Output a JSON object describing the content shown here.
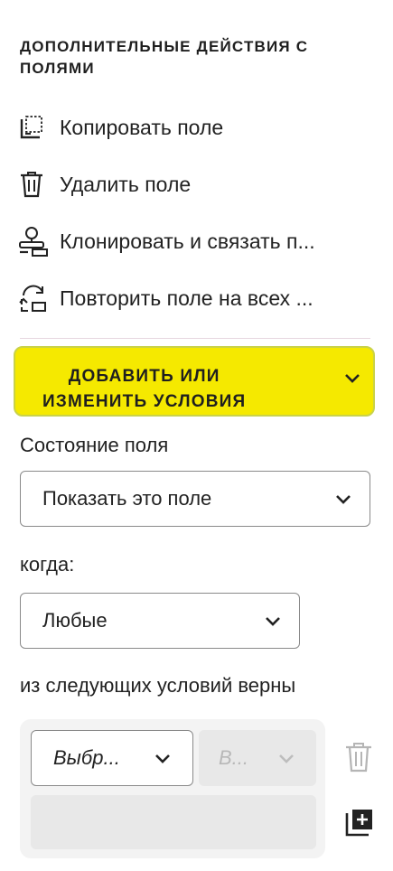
{
  "section": {
    "title": "ДОПОЛНИТЕЛЬНЫЕ ДЕЙСТВИЯ С ПОЛЯМИ"
  },
  "actions": [
    {
      "icon": "copy-field-icon",
      "label": "Копировать поле"
    },
    {
      "icon": "trash-icon",
      "label": "Удалить поле"
    },
    {
      "icon": "clone-link-icon",
      "label": "Клонировать и связать п..."
    },
    {
      "icon": "repeat-all-pages-icon",
      "label": "Повторить поле на всех ..."
    }
  ],
  "conditions": {
    "title_line1": "ДОБАВИТЬ ИЛИ",
    "title_line2": "ИЗМЕНИТЬ УСЛОВИЯ",
    "field_state_label": "Состояние поля",
    "field_state_value": "Показать это поле",
    "when_label": "когда:",
    "when_value": "Любые",
    "following_label": "из следующих условий верны",
    "condition_field_value": "Выбр...",
    "condition_operator_value": "В..."
  },
  "colors": {
    "accent_yellow": "#f5e900",
    "accent_border": "#c9d24a"
  }
}
